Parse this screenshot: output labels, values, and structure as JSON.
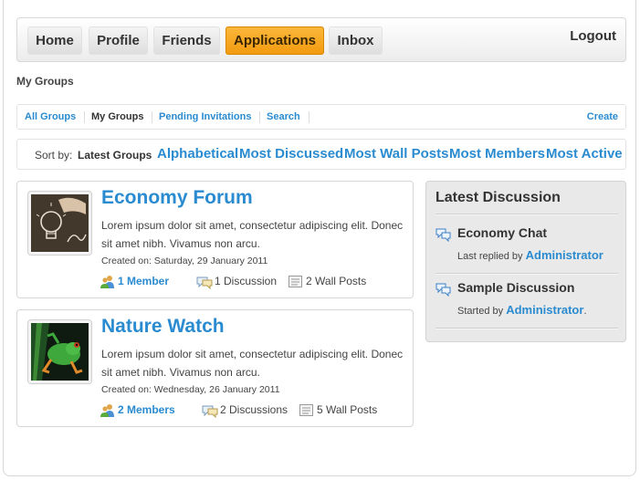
{
  "nav": {
    "items": [
      {
        "label": "Home",
        "active": false
      },
      {
        "label": "Profile",
        "active": false
      },
      {
        "label": "Friends",
        "active": false
      },
      {
        "label": "Applications",
        "active": true
      },
      {
        "label": "Inbox",
        "active": false
      }
    ],
    "logout": "Logout",
    "accent_color": "#f5a623"
  },
  "page": {
    "title": "My Groups"
  },
  "tabs": {
    "items": [
      "All Groups",
      "My Groups",
      "Pending Invitations",
      "Search"
    ],
    "current": "My Groups",
    "create": "Create"
  },
  "sort": {
    "label": "Sort by:",
    "current": "Latest Groups",
    "options": [
      "Alphabetical",
      "Most Discussed",
      "Most Wall Posts",
      "Most Members",
      "Most Active"
    ]
  },
  "groups": [
    {
      "title": "Economy Forum",
      "description": "Lorem ipsum dolor sit amet, consectetur adipiscing elit. Donec sit amet nibh. Vivamus non arcu.",
      "created": "Created on: Saturday, 29 January 2011",
      "members": "1 Member",
      "discussions": "1 Discussion",
      "wall_posts": "2 Wall Posts"
    },
    {
      "title": "Nature Watch",
      "description": "Lorem ipsum dolor sit amet, consectetur adipiscing elit. Donec sit amet nibh. Vivamus non arcu.",
      "created": "Created on: Wednesday, 26 January 2011",
      "members": "2 Members",
      "discussions": "2 Discussions",
      "wall_posts": "5 Wall Posts"
    }
  ],
  "sidebar": {
    "title": "Latest Discussion",
    "items": [
      {
        "title": "Economy Chat",
        "meta_prefix": "Last replied by",
        "user": "Administrator",
        "meta_suffix": ""
      },
      {
        "title": "Sample Discussion",
        "meta_prefix": "Started by",
        "user": "Administrator",
        "meta_suffix": "."
      }
    ]
  }
}
